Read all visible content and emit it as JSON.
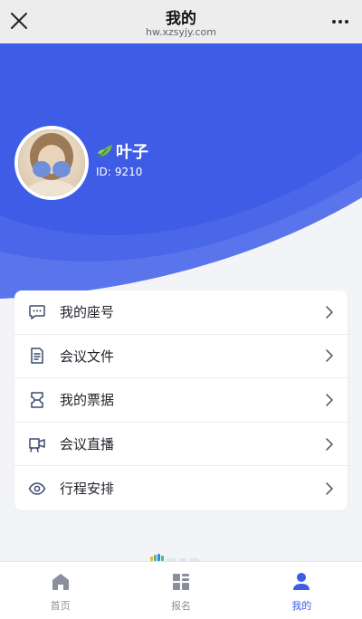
{
  "titlebar": {
    "title": "我的",
    "url": "hw.xzsyjy.com",
    "close_icon": "close-icon",
    "more_icon": "more-dots-icon"
  },
  "profile": {
    "name": "叶子",
    "id_label": "ID:",
    "id_value": "9210",
    "name_icon": "leaf-icon"
  },
  "menu": {
    "items": [
      {
        "label": "我的座号",
        "icon": "chat-bubble-icon"
      },
      {
        "label": "会议文件",
        "icon": "document-icon"
      },
      {
        "label": "我的票据",
        "icon": "ticket-icon"
      },
      {
        "label": "会议直播",
        "icon": "live-camera-icon"
      },
      {
        "label": "行程安排",
        "icon": "eye-icon"
      }
    ]
  },
  "tabbar": {
    "items": [
      {
        "label": "首页",
        "icon": "home-icon",
        "active": false
      },
      {
        "label": "报名",
        "icon": "grid-icon",
        "active": false
      },
      {
        "label": "我的",
        "icon": "user-icon",
        "active": true
      }
    ]
  },
  "colors": {
    "brand_blue": "#3e5ce5",
    "page_background": "#f3f4f7",
    "tab_inactive": "#8a8f99"
  }
}
